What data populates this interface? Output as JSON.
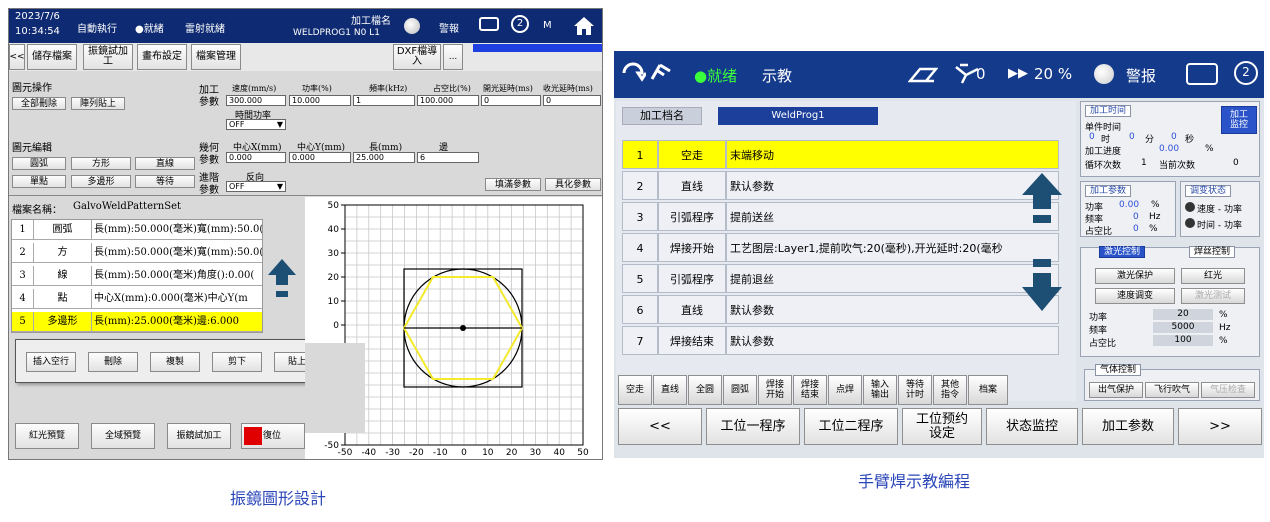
{
  "left": {
    "header": {
      "date": "2023/7/6",
      "time": "10:34:54",
      "mode": "自動執行",
      "state": "●就緒",
      "laser": "雷射就緒",
      "file_label": "加工檔名",
      "file_name": "WELDPROG1 N0 L1",
      "alarm": "警報",
      "m_label": "M"
    },
    "toolbar": {
      "back": "<<",
      "save": "儲存檔案",
      "galvo_test": "振鏡試加工",
      "canvas_set": "畫布設定",
      "file_mgmt": "檔案管理",
      "dxf_import": "DXF檔導入",
      "more": "..."
    },
    "shape_ops": {
      "title": "圖元操作",
      "delete_all": "全部刪除",
      "array_paste": "陣列貼上"
    },
    "shape_edit": {
      "title": "圖元編輯",
      "buttons": [
        "圓弧",
        "方形",
        "直線",
        "單點",
        "多邊形",
        "等待"
      ]
    },
    "proc_params": {
      "label1": "加工",
      "label2": "參數",
      "headers": [
        "速度(mm/s)",
        "功率(%)",
        "頻率(kHz)",
        "占空比(%)",
        "開光延時(ms)",
        "收光延時(ms)"
      ],
      "values": [
        "300.000",
        "10.000",
        "1",
        "100.000",
        "0",
        "0"
      ],
      "time_power_label": "時間功率",
      "time_power_value": "OFF"
    },
    "geo_params": {
      "label1": "幾何",
      "label2": "參數",
      "headers": [
        "中心X(mm)",
        "中心Y(mm)",
        "長(mm)",
        "邊"
      ],
      "values": [
        "0.000",
        "0.000",
        "25.000",
        "6"
      ]
    },
    "adv_params": {
      "label1": "進階",
      "label2": "參數",
      "reverse_label": "反向",
      "reverse_value": "OFF"
    },
    "fill_params": "填滿參數",
    "specialize_params": "具化參數",
    "file_name_label": "檔案名稱：",
    "file_name_value": "GalvoWeldPatternSet",
    "rows": [
      {
        "idx": "1",
        "type": "圓弧",
        "desc": "長(mm):50.000(毫米)寬(mm):50.0("
      },
      {
        "idx": "2",
        "type": "方",
        "desc": "長(mm):50.000(毫米)寬(mm):50.0("
      },
      {
        "idx": "3",
        "type": "線",
        "desc": "長(mm):50.000(毫米)角度():0.00("
      },
      {
        "idx": "4",
        "type": "點",
        "desc": "中心X(mm):0.000(毫米)中心Y(m"
      },
      {
        "idx": "5",
        "type": "多邊形",
        "desc": "長(mm):25.000(毫米)邊:6.000"
      }
    ],
    "popup": {
      "insert": "插入空行",
      "delete": "刪除",
      "copy": "複製",
      "cut": "剪下",
      "paste": "貼上"
    },
    "bottom": {
      "red_preview": "紅光預覽",
      "full_preview": "全域預覽",
      "galvo_test": "振鏡試加工",
      "reset": "復位"
    },
    "plot": {
      "x_ticks": [
        "-50",
        "-40",
        "-30",
        "-20",
        "-10",
        "0",
        "10",
        "20",
        "30",
        "40",
        "50"
      ],
      "y_ticks": [
        "50",
        "40",
        "30",
        "20",
        "10",
        "0",
        "-30",
        "-40",
        "-50"
      ]
    },
    "caption": "振鏡圖形設計"
  },
  "right": {
    "header": {
      "state": "●就绪",
      "mode": "示教",
      "counter": "0",
      "speed": "20 %",
      "alarm": "警报"
    },
    "file_label": "加工档名",
    "file_name": "WeldProg1",
    "rows": [
      {
        "idx": "1",
        "type": "空走",
        "desc": "末端移动"
      },
      {
        "idx": "2",
        "type": "直线",
        "desc": "默认参数"
      },
      {
        "idx": "3",
        "type": "引弧程序",
        "desc": "提前送丝"
      },
      {
        "idx": "4",
        "type": "焊接开始",
        "desc": "工艺图层:Layer1,提前吹气:20(毫秒),开光延时:20(毫秒"
      },
      {
        "idx": "5",
        "type": "引弧程序",
        "desc": "提前退丝"
      },
      {
        "idx": "6",
        "type": "直线",
        "desc": "默认参数"
      },
      {
        "idx": "7",
        "type": "焊接结束",
        "desc": "默认参数"
      }
    ],
    "bottom_tools": [
      "空走",
      "直线",
      "全圆",
      "圆弧",
      "焊接开始",
      "焊接结束",
      "点焊",
      "输入输出",
      "等待计时",
      "其他指令",
      "档案"
    ],
    "nav": [
      "<<",
      "工位一程序",
      "工位二程序",
      "工位预约设定",
      "状态监控",
      "加工参数",
      ">>"
    ],
    "time_panel": {
      "title": "加工时间",
      "monitor": "加工监控",
      "unit_time": "单件时间",
      "h": "0",
      "h_label": "时",
      "m": "0",
      "m_label": "分",
      "s": "0",
      "s_label": "秒",
      "progress_label": "加工进度",
      "progress_value": "0.00",
      "percent": "%",
      "loop_label": "循环次数",
      "loop_value": "1",
      "current_label": "当前次数",
      "current_value": "0"
    },
    "params_panel": {
      "title": "加工参数",
      "power_label": "功率",
      "power_value": "0.00",
      "power_unit": "%",
      "freq_label": "频率",
      "freq_value": "0",
      "freq_unit": "Hz",
      "duty_label": "占空比",
      "duty_value": "0",
      "duty_unit": "%"
    },
    "adjust_panel": {
      "title": "调变状态",
      "opt1": "速度 - 功率",
      "opt2": "时间 - 功率"
    },
    "laser_control": {
      "tab1": "激光控制",
      "tab2": "焊丝控制",
      "laser_protect": "激光保护",
      "red_light": "红光",
      "speed_adjust": "速度调变",
      "laser_test": "激光测试",
      "power_label": "功率",
      "power_value": "20",
      "power_unit": "%",
      "freq_label": "频率",
      "freq_value": "5000",
      "freq_unit": "Hz",
      "duty_label": "占空比",
      "duty_value": "100",
      "duty_unit": "%"
    },
    "gas_control": {
      "title": "气体控制",
      "gas_protect": "出气保护",
      "fly_blow": "飞行吹气",
      "gas_check": "气压检查"
    },
    "caption": "手臂焊示教編程"
  },
  "colors": {
    "left_header": "#0e2a72",
    "right_header": "#143a8c",
    "highlight": "#ffff00",
    "accent_blue": "#2b4fd6",
    "hexagon": "#f2ea2a"
  }
}
